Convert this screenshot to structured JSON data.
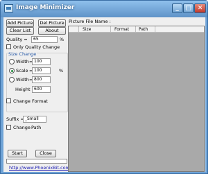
{
  "window": {
    "title": "Image Minimizer"
  },
  "toolbar": {
    "add_picture": "Add Picture",
    "del_picture": "Del Picture",
    "clear_list": "Clear List",
    "about": "About"
  },
  "quality": {
    "label": "Quality =",
    "value": "65",
    "unit": "%"
  },
  "only_quality_change": {
    "label": "Only Quality Change",
    "checked": false
  },
  "size_change": {
    "title": "Size Change",
    "width1": {
      "label": "Width",
      "eq": "=",
      "value": "100",
      "selected": false
    },
    "scale": {
      "label": "Scale",
      "eq": "=",
      "value": "100",
      "unit": "%",
      "selected": true
    },
    "width2": {
      "label": "Width",
      "eq": "=",
      "value": "800",
      "selected": false
    },
    "height": {
      "label": "Height =",
      "value": "600"
    }
  },
  "change_format": {
    "label": "Change Format",
    "checked": false
  },
  "suffix": {
    "label": "Suffix =",
    "value": "_Small"
  },
  "change_path": {
    "label": "Change",
    "path_label": "Path",
    "checked": false
  },
  "actions": {
    "start": "Start",
    "close": "Close"
  },
  "footer_link": "http://www.PhoenixBit.com",
  "list": {
    "label": "Picture File Name :",
    "columns": [
      "Size",
      "Format",
      "Path"
    ]
  },
  "progress": 0
}
